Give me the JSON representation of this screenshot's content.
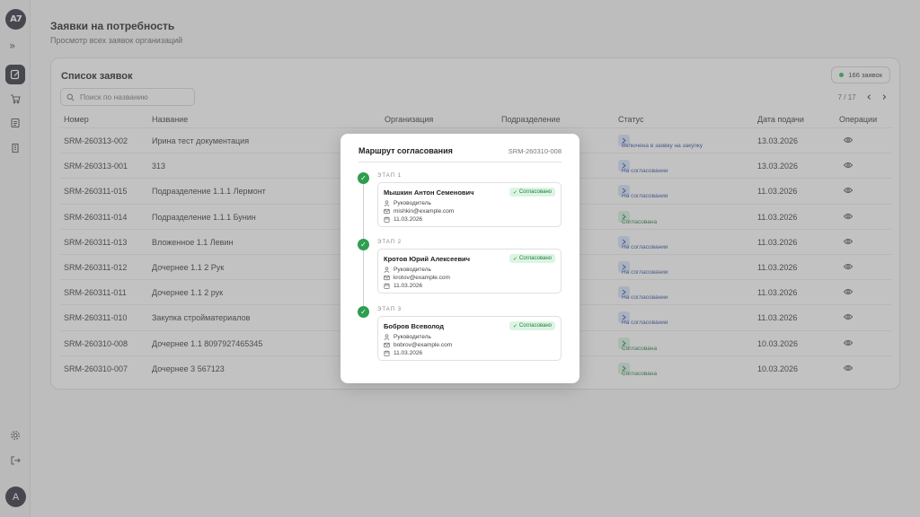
{
  "sidebar": {
    "logo": "A7",
    "expand": "»",
    "avatar": "A"
  },
  "page": {
    "title": "Заявки на потребность",
    "subtitle": "Просмотр всех заявок организаций"
  },
  "list": {
    "title": "Список заявок",
    "count": "166 заявок",
    "search_placeholder": "Поиск по названию",
    "pager": "7 / 17",
    "prev": "‹",
    "next": "›",
    "columns": [
      "Номер",
      "Название",
      "Организация",
      "Подразделение",
      "Статус",
      "Дата подачи",
      "Операции"
    ],
    "rows": [
      {
        "number": "SRM-260313-002",
        "name": "Ирина тест документация",
        "status": "Включена в заявку на закупку",
        "date": "13.03.2026"
      },
      {
        "number": "SRM-260313-001",
        "name": "313",
        "status": "На согласовании",
        "date": "13.03.2026"
      },
      {
        "number": "SRM-260311-015",
        "name": "Подразделение 1.1.1 Лермонт",
        "status": "На согласовании",
        "date": "11.03.2026"
      },
      {
        "number": "SRM-260311-014",
        "name": "Подразделение 1.1.1 Бунин",
        "status": "Согласована",
        "date": "11.03.2026"
      },
      {
        "number": "SRM-260311-013",
        "name": "Вложенное 1.1 Левин",
        "status": "На согласовании",
        "date": "11.03.2026"
      },
      {
        "number": "SRM-260311-012",
        "name": "Дочернее 1.1 2 Рук",
        "status": "На согласовании",
        "date": "11.03.2026"
      },
      {
        "number": "SRM-260311-011",
        "name": "Дочернее 1.1 2 рук",
        "status": "На согласовании",
        "date": "11.03.2026"
      },
      {
        "number": "SRM-260311-010",
        "name": "Закупка стройматериалов",
        "status": "На согласовании",
        "date": "11.03.2026"
      },
      {
        "number": "SRM-260310-008",
        "name": "Дочернее 1.1 8097927465345",
        "status": "Согласована",
        "date": "10.03.2026"
      },
      {
        "number": "SRM-260310-007",
        "name": "Дочернее 3 567123",
        "status": "Согласована",
        "date": "10.03.2026"
      }
    ]
  },
  "modal": {
    "title": "Маршрут согласования",
    "id": "SRM-260310-008",
    "stages": [
      {
        "label": "ЭТАП 1",
        "name": "Мышкин Антон Семенович",
        "badge": "Согласовано",
        "role": "Руководитель",
        "email": "mishkin@example.com",
        "date": "11.03.2026"
      },
      {
        "label": "ЭТАП 2",
        "name": "Кротов Юрий Алексеевич",
        "badge": "Согласовано",
        "role": "Руководитель",
        "email": "krotov@example.com",
        "date": "11.03.2026"
      },
      {
        "label": "ЭТАП 3",
        "name": "Бобров Всеволод",
        "badge": "Согласовано",
        "role": "Руководитель",
        "email": "bobrov@example.com",
        "date": "11.03.2026"
      }
    ]
  },
  "colors": {
    "status_blue": "#d6e4fb",
    "status_green": "#d4f1dc",
    "accent_dark": "#2b2d3a",
    "success": "#2e9e4f"
  }
}
